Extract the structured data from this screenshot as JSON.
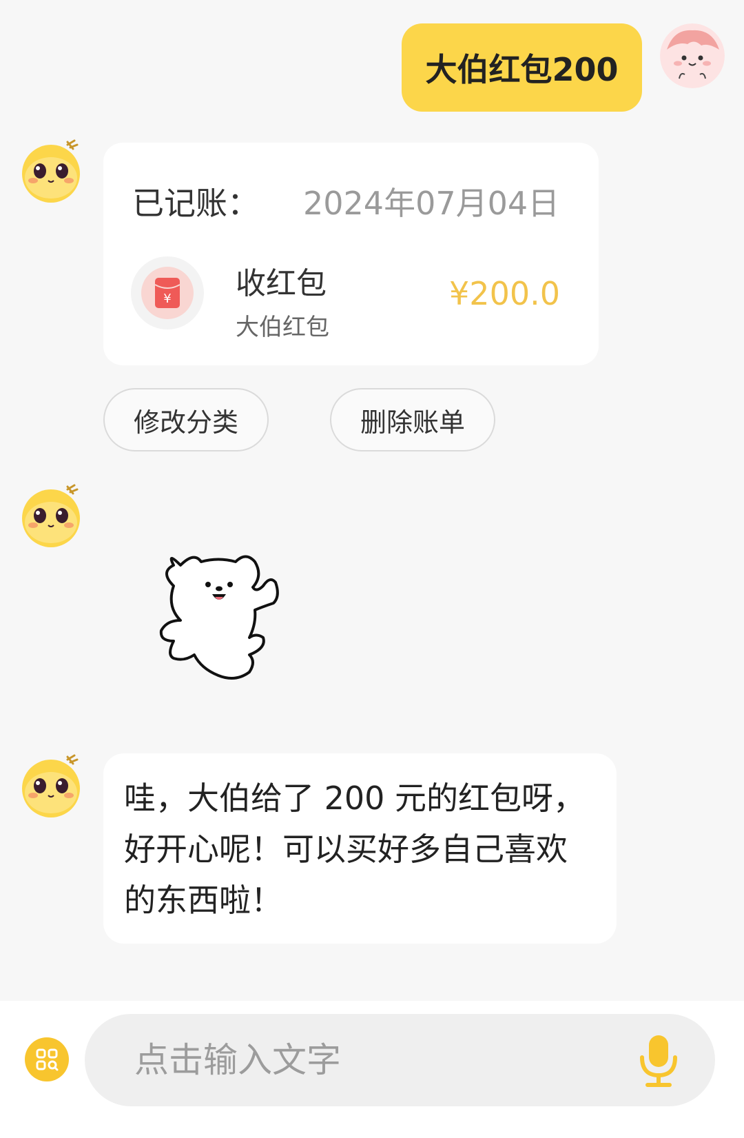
{
  "user_message": {
    "text": "大伯红包200",
    "avatar_icon": "pink-cat-avatar-icon"
  },
  "bot": {
    "avatar_icon": "yellow-coin-face-avatar-icon"
  },
  "record_card": {
    "label": "已记账：",
    "date": "2024年07月04日",
    "category_icon": "red-envelope-icon",
    "category_name": "收红包",
    "note": "大伯红包",
    "amount": "¥200.0"
  },
  "actions": {
    "modify_label": "修改分类",
    "delete_label": "删除账单"
  },
  "sticker": {
    "icon": "dancing-white-bear-sticker"
  },
  "reply": {
    "text": "哇，大伯给了 200 元的红包呀，好开心呢！可以买好多自己喜欢的东西啦！"
  },
  "input": {
    "placeholder": "点击输入文字",
    "value": "",
    "menu_icon": "grid-menu-icon",
    "voice_icon": "microphone-icon"
  },
  "colors": {
    "accent": "#fcd64a",
    "amount": "#f2c34b",
    "background": "#f7f7f7"
  }
}
